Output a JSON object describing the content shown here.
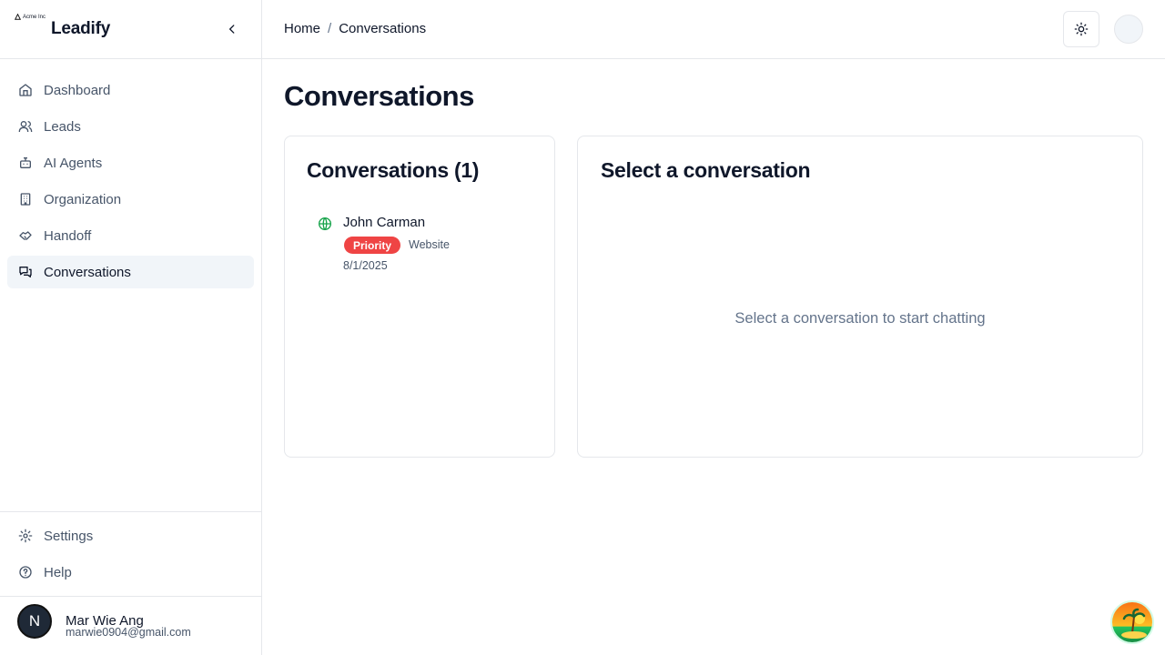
{
  "brand": {
    "company": "Acme Inc",
    "name": "Leadify"
  },
  "sidebar": {
    "items": [
      {
        "label": "Dashboard",
        "icon": "home-icon"
      },
      {
        "label": "Leads",
        "icon": "users-icon"
      },
      {
        "label": "AI Agents",
        "icon": "bot-icon"
      },
      {
        "label": "Organization",
        "icon": "building-icon"
      },
      {
        "label": "Handoff",
        "icon": "handshake-icon"
      },
      {
        "label": "Conversations",
        "icon": "messages-icon",
        "active": true
      }
    ],
    "bottom_items": [
      {
        "label": "Settings",
        "icon": "gear-icon"
      },
      {
        "label": "Help",
        "icon": "help-circle-icon"
      }
    ],
    "user": {
      "initial": "N",
      "name": "Mar Wie Ang",
      "email": "marwie0904@gmail.com"
    }
  },
  "header": {
    "breadcrumb": [
      "Home",
      "Conversations"
    ],
    "breadcrumb_separator": "/"
  },
  "main": {
    "title": "Conversations",
    "list": {
      "title": "Conversations (1)",
      "items": [
        {
          "name": "John Carman",
          "badge": "Priority",
          "source": "Website",
          "date": "8/1/2025",
          "icon": "globe-icon"
        }
      ]
    },
    "detail": {
      "title": "Select a conversation",
      "empty_message": "Select a conversation to start chatting"
    }
  },
  "colors": {
    "priority": "#ef4444",
    "globe": "#16a34a",
    "active_bg": "#f1f5f9",
    "border": "#e5e7eb"
  }
}
